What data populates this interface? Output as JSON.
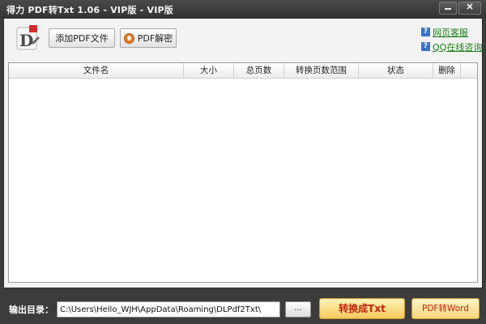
{
  "window": {
    "title": "得力 PDF转Txt 1.06 - VIP版 - VIP版",
    "minimize_icon": "minimize-icon",
    "close_icon": "close-icon"
  },
  "toolbar": {
    "logo_icon": "app-logo-icon",
    "add_pdf_label": "添加PDF文件",
    "decrypt_label": "PDF解密",
    "decrypt_icon": "unlock-icon"
  },
  "links": {
    "help_icon": "question-icon",
    "online_service": "网页客服",
    "qq_consult": "QQ在线咨询"
  },
  "file_table": {
    "columns": [
      "文件名",
      "大小",
      "总页数",
      "转换页数范围",
      "状态",
      "删除"
    ],
    "rows": []
  },
  "footer": {
    "output_label": "输出目录：",
    "output_path": "C:\\Users\\Hello_WJH\\AppData\\Roaming\\DLPdf2Txt\\",
    "browse_label": "...",
    "convert_label": "转换成Txt",
    "to_word_label": "PDF转Word"
  },
  "colors": {
    "titlebar": "#3c3c3c",
    "link_green": "#1a7f16",
    "convert_red": "#c1220a",
    "convert_yellow": "#f6c85a"
  }
}
